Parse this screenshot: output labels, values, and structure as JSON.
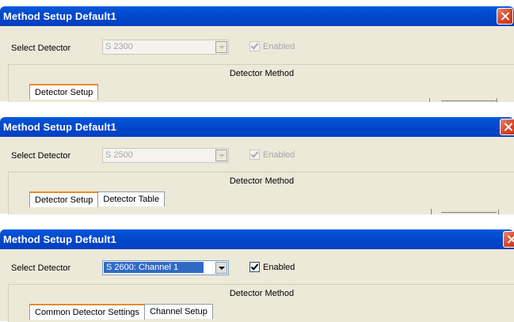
{
  "panels": [
    {
      "title": "Method Setup Default1",
      "select_label": "Select Detector",
      "detector_value": "S 2300",
      "enabled_label": "Enabled",
      "enabled_state": "disabled",
      "group_label": "Detector Method",
      "tabs": [
        "Detector Setup"
      ]
    },
    {
      "title": "Method Setup Default1",
      "select_label": "Select Detector",
      "detector_value": "S 2500",
      "enabled_label": "Enabled",
      "enabled_state": "disabled",
      "group_label": "Detector Method",
      "tabs": [
        "Detector Setup",
        "Detector Table"
      ]
    },
    {
      "title": "Method Setup Default1",
      "select_label": "Select Detector",
      "detector_value": "S 2600: Channel 1",
      "enabled_label": "Enabled",
      "enabled_state": "enabled",
      "group_label": "Detector Method",
      "tabs": [
        "Common Detector Settings",
        "Channel Setup"
      ]
    }
  ],
  "colors": {
    "titlebar": "#0353d6",
    "dialog_bg": "#ece9d8",
    "close_button": "#d6492b",
    "selection": "#316ac5",
    "active_tab_accent": "#e68b2c"
  },
  "icons": [
    "close-icon",
    "chevron-down-icon",
    "checkmark-icon"
  ]
}
